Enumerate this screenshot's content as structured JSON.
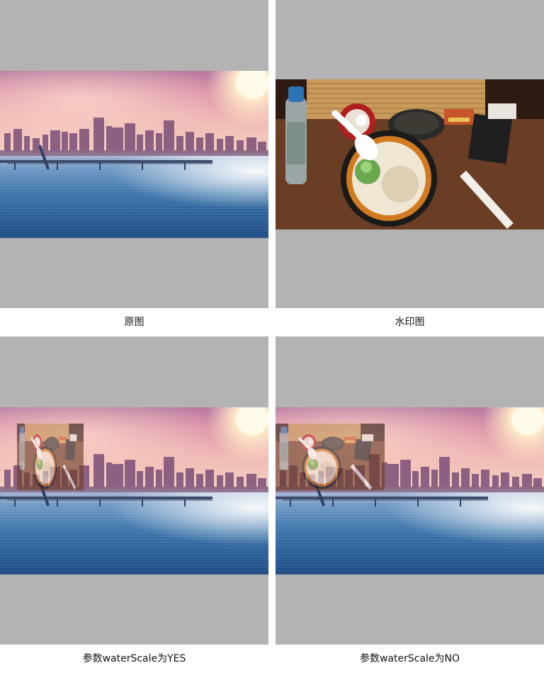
{
  "captions": {
    "original": "原图",
    "watermark": "水印图",
    "scale_yes": "参数waterScale为YES",
    "scale_no": "参数waterScale为NO"
  },
  "colors": {
    "panel_background": "#b3b3b3",
    "page_background": "#ffffff"
  }
}
